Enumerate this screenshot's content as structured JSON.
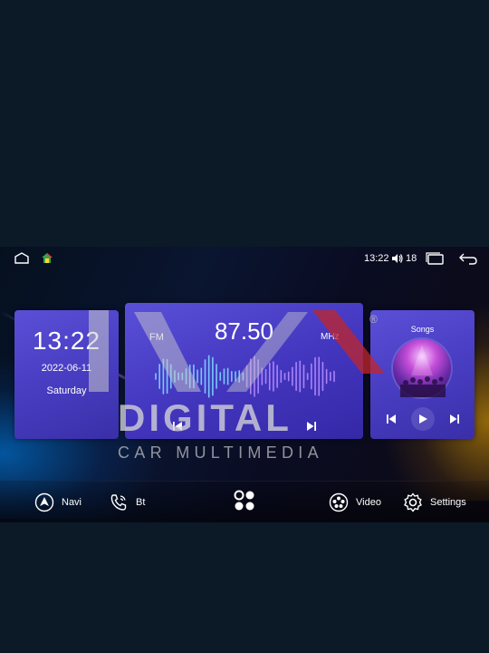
{
  "statusbar": {
    "time": "13:22",
    "volume": "18",
    "icons": [
      "home-outline-icon",
      "home-color-icon",
      "volume-icon",
      "recent-apps-icon",
      "back-icon"
    ]
  },
  "clock_widget": {
    "time": "13:22",
    "date": "2022-06-11",
    "weekday": "Saturday"
  },
  "radio_widget": {
    "band": "FM",
    "frequency": "87.50",
    "unit": "MHz",
    "icons": [
      "previous-icon",
      "next-icon"
    ]
  },
  "music_widget": {
    "title": "Songs",
    "icons": [
      "previous-icon",
      "play-icon",
      "next-icon"
    ]
  },
  "dock": {
    "navi_label": "Navi",
    "bt_label": "Bt",
    "video_label": "Video",
    "settings_label": "Settings",
    "icons": [
      "navi-icon",
      "phone-icon",
      "apps-icon",
      "video-icon",
      "settings-icon"
    ]
  },
  "watermark": {
    "brand": "DIGITAL",
    "subtitle": "CAR MULTIMEDIA",
    "registered": "®"
  },
  "colors": {
    "card": "#4a3fc4",
    "watermark_red": "#c0262b",
    "watermark_gray": "#c8c8cc"
  }
}
